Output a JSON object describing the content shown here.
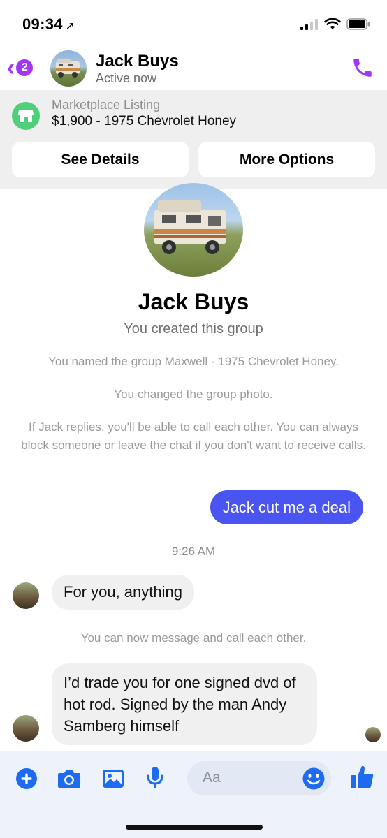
{
  "status_bar": {
    "time": "09:34"
  },
  "header": {
    "back_badge": "2",
    "name": "Jack Buys",
    "status": "Active now"
  },
  "marketplace": {
    "label": "Marketplace Listing",
    "title": "$1,900 - 1975 Chevrolet Honey",
    "see_details": "See Details",
    "more_options": "More Options"
  },
  "group": {
    "name": "Jack Buys",
    "subtitle": "You created this group"
  },
  "system_messages": {
    "renamed": "You named the group Maxwell · 1975 Chevrolet Honey.",
    "photo": "You changed the group photo.",
    "calls": "If Jack replies, you'll be able to call each other. You can always block someone or leave the chat if you don't want to receive calls.",
    "can_message": "You can now message and call each other."
  },
  "messages": {
    "outgoing_1": "Jack cut me a deal",
    "timestamp_1": "9:26 AM",
    "incoming_1": "For you, anything",
    "incoming_2": "I’d trade you for one signed dvd of hot rod. Signed by the man Andy Samberg himself"
  },
  "composer": {
    "placeholder": "Aa"
  },
  "colors": {
    "accent_purple": "#a334fa",
    "outgoing_bubble": "#4a54f1",
    "composer_blue": "#1e6bf0",
    "marketplace_green": "#4fcf7a"
  }
}
